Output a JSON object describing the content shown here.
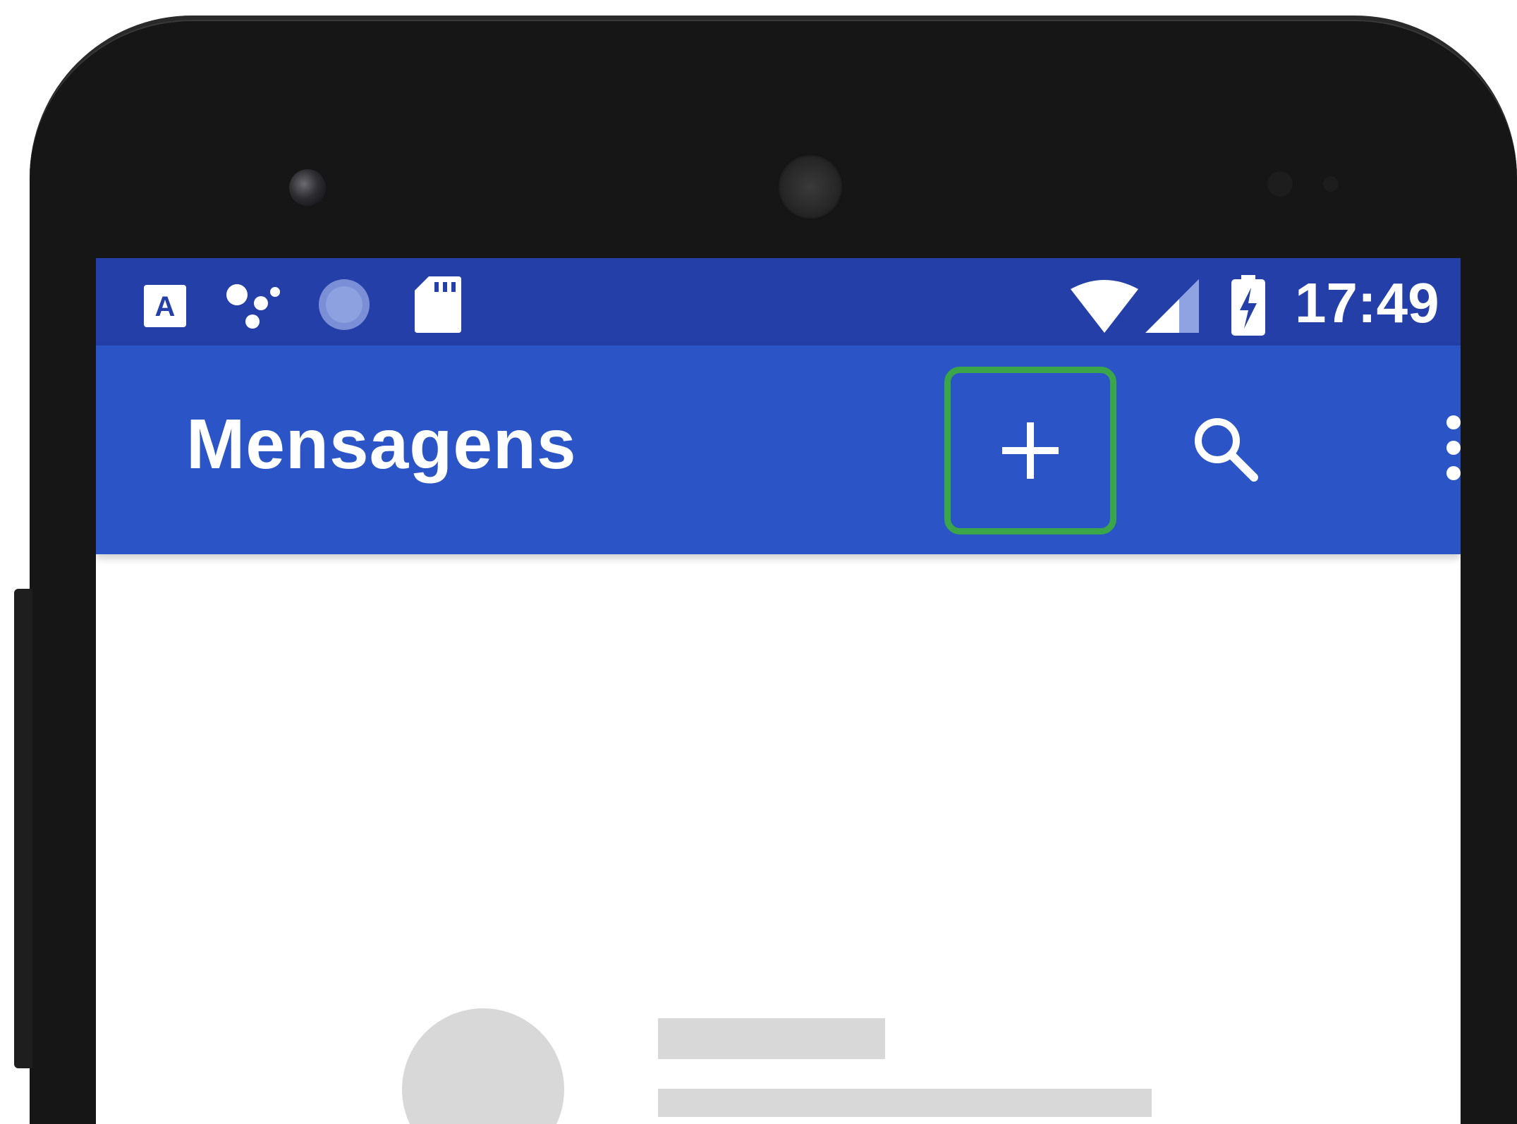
{
  "status_bar": {
    "time": "17:49",
    "left_icons": [
      "a-notification-icon",
      "assistant-icon",
      "circle-notification-icon",
      "sd-card-icon"
    ],
    "right_icons": [
      "wifi-icon",
      "signal-icon",
      "battery-charging-icon"
    ]
  },
  "app_bar": {
    "title": "Mensagens",
    "actions": [
      {
        "name": "add-action",
        "icon": "plus-icon",
        "highlighted": true
      },
      {
        "name": "search-action",
        "icon": "search-icon"
      },
      {
        "name": "more-action",
        "icon": "more-vertical-icon"
      }
    ]
  },
  "colors": {
    "status_bar": "#2440a8",
    "app_bar": "#2b55c6",
    "highlight": "#3aa649",
    "placeholder": "#d8d8d8",
    "phone_body": "#161616"
  }
}
